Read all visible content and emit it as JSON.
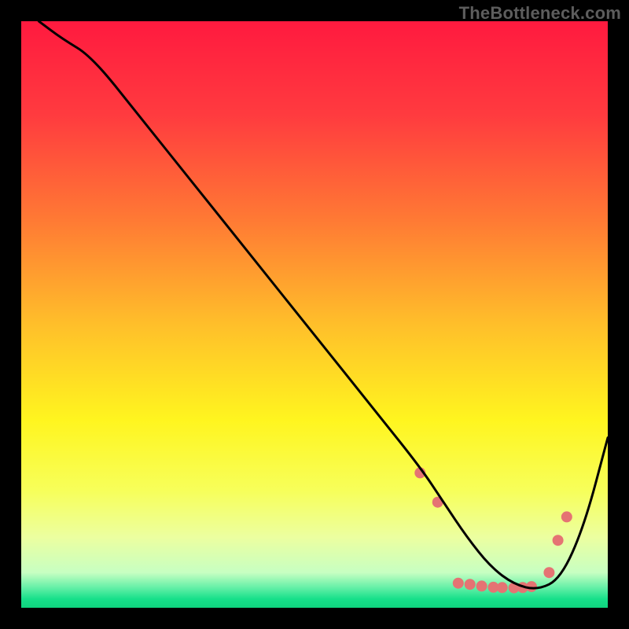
{
  "attribution": "TheBottleneck.com",
  "chart_data": {
    "type": "line",
    "title": "",
    "xlabel": "",
    "ylabel": "",
    "xlim": [
      0,
      100
    ],
    "ylim": [
      0,
      100
    ],
    "grid": false,
    "legend": false,
    "gradient_stops": [
      {
        "pos": 0.0,
        "color": "#ff1a3f"
      },
      {
        "pos": 0.16,
        "color": "#ff3b3f"
      },
      {
        "pos": 0.34,
        "color": "#ff7a34"
      },
      {
        "pos": 0.52,
        "color": "#ffc02a"
      },
      {
        "pos": 0.68,
        "color": "#fff51f"
      },
      {
        "pos": 0.8,
        "color": "#f7ff5a"
      },
      {
        "pos": 0.88,
        "color": "#ecffa0"
      },
      {
        "pos": 0.94,
        "color": "#c7ffc2"
      },
      {
        "pos": 0.965,
        "color": "#67f0a8"
      },
      {
        "pos": 0.985,
        "color": "#17e08a"
      },
      {
        "pos": 1.0,
        "color": "#0fd47e"
      }
    ],
    "series": [
      {
        "name": "bottleneck-curve",
        "color": "#000000",
        "x": [
          3,
          7,
          12,
          20,
          30,
          40,
          50,
          60,
          68,
          72,
          76,
          80,
          84,
          88,
          92,
          96,
          100
        ],
        "y": [
          100,
          97,
          94,
          84,
          71.5,
          59,
          46.5,
          34,
          24,
          18,
          12,
          7,
          4,
          3,
          5,
          14,
          29
        ]
      }
    ],
    "markers": {
      "name": "highlighted-points",
      "color": "#e57373",
      "radius": 7,
      "x": [
        68,
        71,
        74.5,
        76.5,
        78.5,
        80.5,
        82,
        84,
        85.5,
        87,
        90,
        91.5,
        93
      ],
      "y": [
        23,
        18,
        4.2,
        4.0,
        3.7,
        3.5,
        3.45,
        3.4,
        3.45,
        3.6,
        6,
        11.5,
        15.5
      ]
    }
  }
}
